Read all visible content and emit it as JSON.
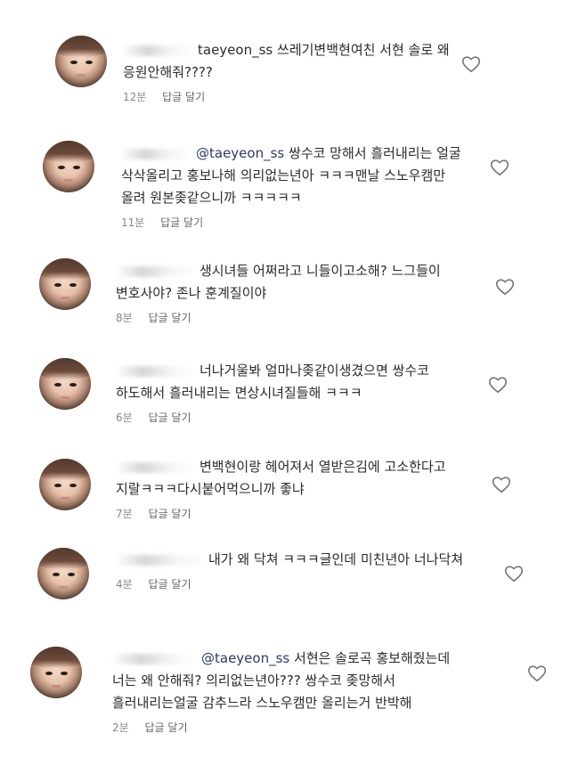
{
  "comments": [
    {
      "user": "taeyeon_ss",
      "lines": [
        "쓰레기변백현여친 서현 솔로 왜",
        "응원안해줘????"
      ],
      "time": "12분",
      "reply_label": "답글 달기"
    },
    {
      "user": "",
      "mention": "@taeyeon_ss",
      "lines": [
        "쌍수코 망해서 흘러내리는 얼굴",
        "삭삭올리고 홍보나해 의리없는년아 ㅋㅋㅋ맨날 스노우캠만",
        "올려 원본좆같으니까 ㅋㅋㅋㅋㅋ"
      ],
      "time": "11분",
      "reply_label": "답글 달기"
    },
    {
      "user": "",
      "lines": [
        "생시녀들 어쩌라고 니들이고소해? 느그들이",
        "변호사야? 존나 훈계질이야"
      ],
      "time": "8분",
      "reply_label": "답글 달기"
    },
    {
      "user": "",
      "lines": [
        "너나거울봐 얼마나좆같이생겼으면 쌍수코",
        "하도해서 흘러내리는 면상시녀질들해 ㅋㅋㅋ"
      ],
      "time": "6분",
      "reply_label": "답글 달기"
    },
    {
      "user": "",
      "lines": [
        "변백현이랑 헤어져서 열받은김에 고소한다고",
        "지랄ㅋㅋㅋ다시붙어먹으니까 좋냐"
      ],
      "time": "7분",
      "reply_label": "답글 달기"
    },
    {
      "user": "",
      "lines": [
        "내가 왜 닥쳐 ㅋㅋㅋ글인데 미친년아 너나닥쳐"
      ],
      "time": "4분",
      "reply_label": "답글 달기"
    },
    {
      "user": "",
      "mention": "@taeyeon_ss",
      "lines": [
        "서현은 솔로곡 홍보해줬는데",
        "너는 왜 안해줘? 의리없는년아??? 쌍수코 좆망해서",
        "흘러내리는얼굴 감추느라 스노우캠만 올리는거 반박해"
      ],
      "time": "2분",
      "reply_label": "답글 달기"
    }
  ],
  "colors": {
    "heart_stroke": "#777777",
    "meta": "#888888",
    "mention": "#2b3b66"
  },
  "icons": {
    "heart": "heart-icon"
  }
}
